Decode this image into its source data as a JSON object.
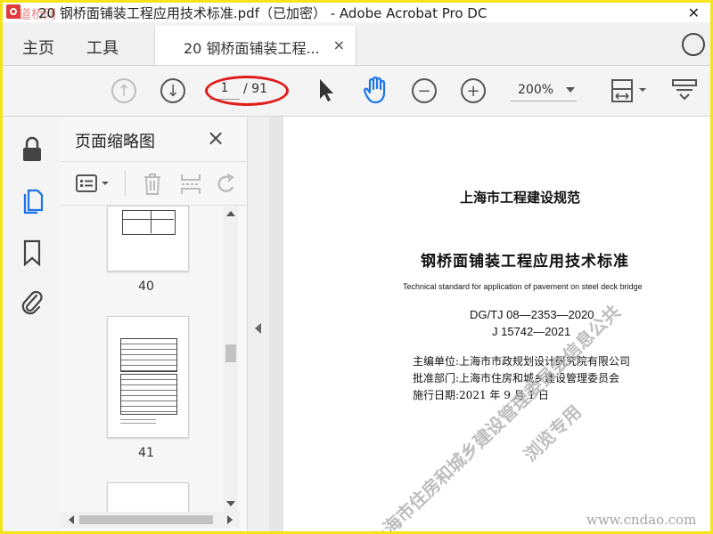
{
  "window": {
    "title": "20 钢桥面铺装工程应用技术标准.pdf（已加密） - Adobe Acrobat Pro DC",
    "corner_watermark": "道桥网"
  },
  "nav": {
    "home": "主页",
    "tools": "工具",
    "doc_tab": "20 钢桥面铺装工程...",
    "doc_tab_close": "×"
  },
  "toolbar": {
    "page_current": "1",
    "page_total": "/ 91",
    "zoom": "200%",
    "highlight_color": "#e11a1a",
    "hand_color": "#1a73e8"
  },
  "panel": {
    "title": "页面缩略图",
    "close": "×",
    "thumbnails": [
      {
        "label": "40"
      },
      {
        "label": "41"
      }
    ]
  },
  "document": {
    "series": "上海市工程建设规范",
    "title": "钢桥面铺装工程应用技术标准",
    "title_en": "Technical standard for application of pavement on steel deck bridge",
    "code": "DG/TJ 08—2353—2020",
    "record": "J 15742—2021",
    "chief_editor": "主编单位:上海市市政规划设计研究院有限公司",
    "approver": "批准部门:上海市住房和城乡建设管理委员会",
    "effective": "施行日期:2021 年 9 月 1 日"
  },
  "watermarks": {
    "line1": "上海市住房和城乡建设管理委员会信息公共",
    "line2": "浏览专用",
    "site": "www.cndao.com"
  }
}
